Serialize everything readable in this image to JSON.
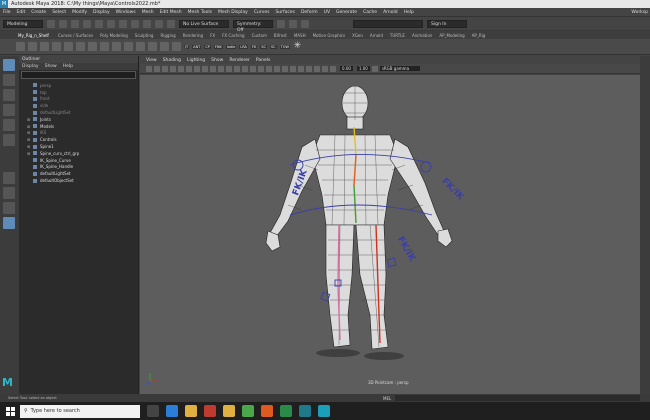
{
  "window": {
    "title": "Autodesk Maya 2018: C:\\My things\\Maya\\Controls2022.mb*"
  },
  "menubar": {
    "items": [
      "File",
      "Edit",
      "Create",
      "Select",
      "Modify",
      "Display",
      "Windows",
      "Mesh",
      "Edit Mesh",
      "Mesh Tools",
      "Mesh Display",
      "Curves",
      "Surfaces",
      "Deform",
      "UV",
      "Generate",
      "Cache",
      "Arnold",
      "Help"
    ],
    "workspace": "Worksp"
  },
  "statusline": {
    "mode": "Modeling",
    "live_surface": "No Live Surface",
    "symmetry": "Symmetry: Off",
    "sign_in": "Sign In"
  },
  "shelf_tabs": {
    "current": "My_Rig_n_Shelf",
    "items": [
      "Curves / Surfaces",
      "Poly Modeling",
      "Sculpting",
      "Rigging",
      "Rendering",
      "FX",
      "FX Caching",
      "Custom",
      "Bifrost",
      "MASH",
      "Motion Graphics",
      "XGen",
      "Arnold",
      "TURTLE",
      "Animation",
      "AP_Modeling",
      "AP_Rig"
    ]
  },
  "shelf_labels": [
    "JT",
    "ANT",
    "CP",
    "FNK",
    "ladle",
    "LRA",
    "FK",
    "SC",
    "SC",
    "TOW"
  ],
  "outliner": {
    "title": "Outliner",
    "menu": [
      "Display",
      "Show",
      "Help"
    ],
    "rows": [
      {
        "label": "persp",
        "dim": true,
        "expand": false
      },
      {
        "label": "top",
        "dim": true,
        "expand": false
      },
      {
        "label": "front",
        "dim": true,
        "expand": false
      },
      {
        "label": "side",
        "dim": true,
        "expand": false
      },
      {
        "label": "defaultLightSet",
        "dim": true,
        "expand": false
      },
      {
        "label": "Joints",
        "dim": false,
        "expand": true
      },
      {
        "label": "Models",
        "dim": false,
        "expand": true
      },
      {
        "label": "IKS",
        "dim": true,
        "expand": true
      },
      {
        "label": "Controls",
        "dim": false,
        "expand": true
      },
      {
        "label": "Spine1",
        "dim": false,
        "expand": true
      },
      {
        "label": "Spine_curv_ctrl_grp",
        "dim": false,
        "expand": true
      },
      {
        "label": "IK_Spine_Curve",
        "dim": false,
        "expand": false
      },
      {
        "label": "IK_Spine_Handle",
        "dim": false,
        "expand": false
      },
      {
        "label": "defaultLightSet",
        "dim": false,
        "expand": false
      },
      {
        "label": "defaultObjectSet",
        "dim": false,
        "expand": false
      }
    ]
  },
  "viewport": {
    "menu": [
      "View",
      "Shading",
      "Lighting",
      "Show",
      "Renderer",
      "Panels"
    ],
    "near_value": "0.00",
    "far_value": "1.00",
    "color_space": "sRGB gamma",
    "camera_label": "3D Pointcam : persp",
    "fk_ik_labels": [
      "FK/IK",
      "FK/IK",
      "FK/IK"
    ]
  },
  "helpline": {
    "message": "Select Tool: select an object",
    "mel": "MEL"
  },
  "taskbar": {
    "search_placeholder": "Type here to search"
  },
  "colors": {
    "accent": "#5e8bb8",
    "viewport_bg": "#5d5d5d",
    "control_curve": "#3a3fa8"
  }
}
